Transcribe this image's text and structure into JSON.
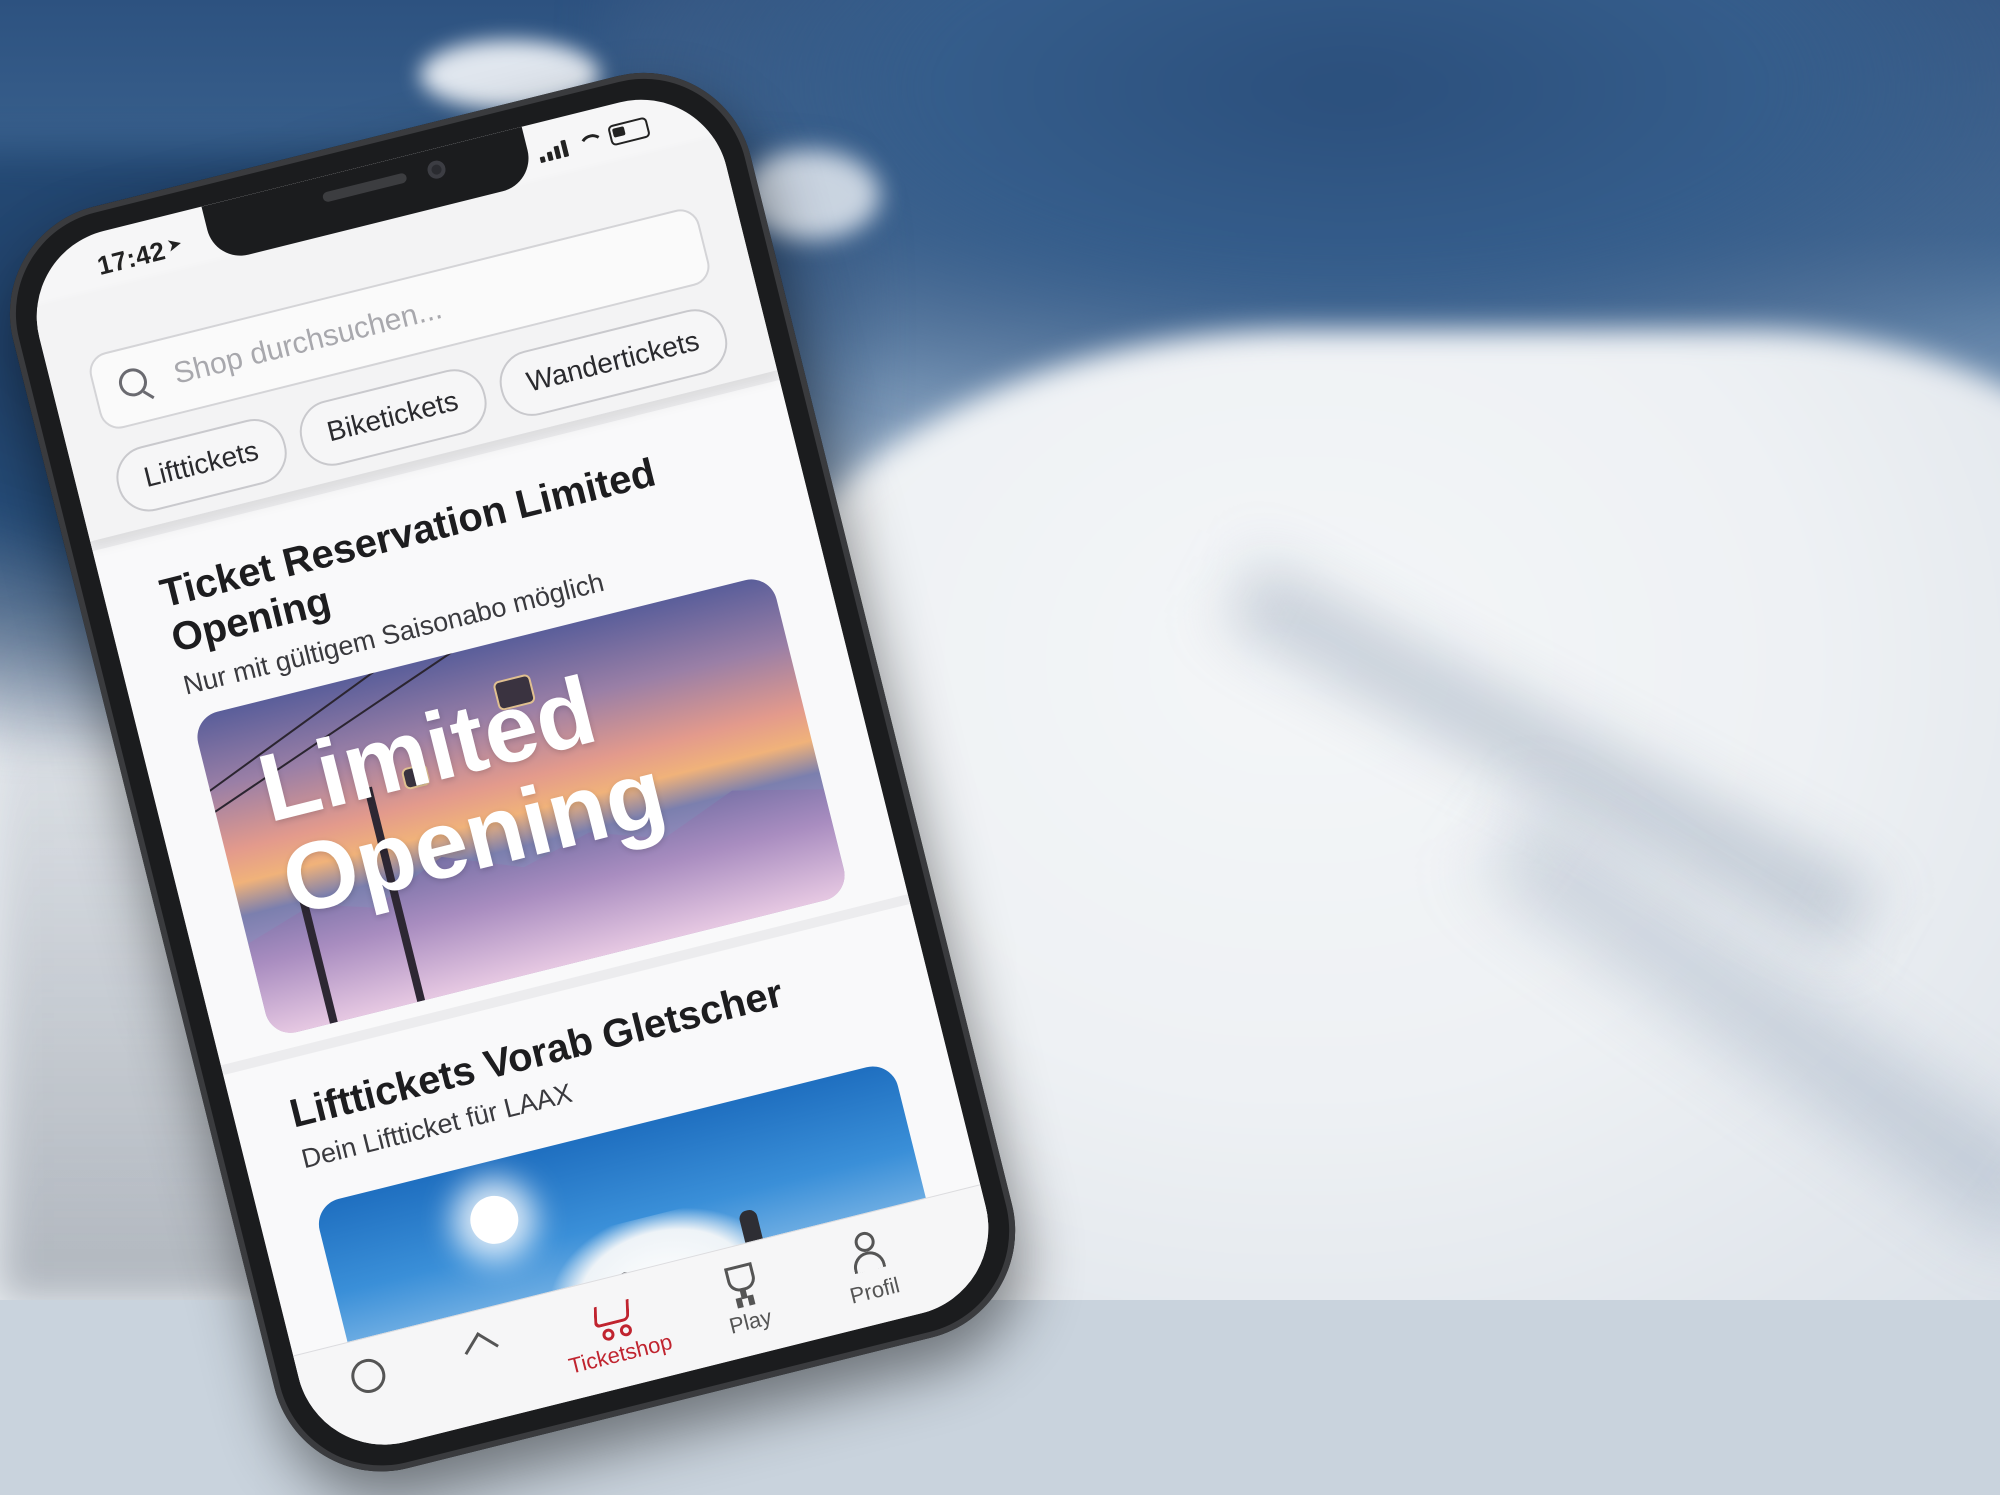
{
  "status_bar": {
    "time": "17:42",
    "location_arrow": "location-arrow-icon",
    "icons": [
      "signal-icon",
      "wifi-icon",
      "battery-icon"
    ]
  },
  "search": {
    "placeholder": "Shop durchsuchen..."
  },
  "filter_chips": [
    "Lifttickets",
    "Biketickets",
    "Wandertickets"
  ],
  "cards": [
    {
      "title": "Ticket Reservation Limited Opening",
      "subtitle": "Nur mit gültigem Saisonabo möglich",
      "banner_text_line1": "Limited",
      "banner_text_line2": "Opening"
    },
    {
      "title": "Lifttickets Vorab Gletscher",
      "subtitle": "Dein Liftticket für LAAX"
    }
  ],
  "tab_bar": {
    "items": [
      {
        "label": "",
        "icon": "home-icon",
        "active": false
      },
      {
        "label": "",
        "icon": "mountain-icon",
        "active": false
      },
      {
        "label": "Ticketshop",
        "icon": "cart-icon",
        "active": true
      },
      {
        "label": "Play",
        "icon": "trophy-icon",
        "active": false
      },
      {
        "label": "Profil",
        "icon": "person-icon",
        "active": false
      }
    ]
  },
  "colors": {
    "accent": "#c0242f",
    "phone_frame": "#1b1c1e",
    "screen_bg": "#f6f6f7"
  }
}
